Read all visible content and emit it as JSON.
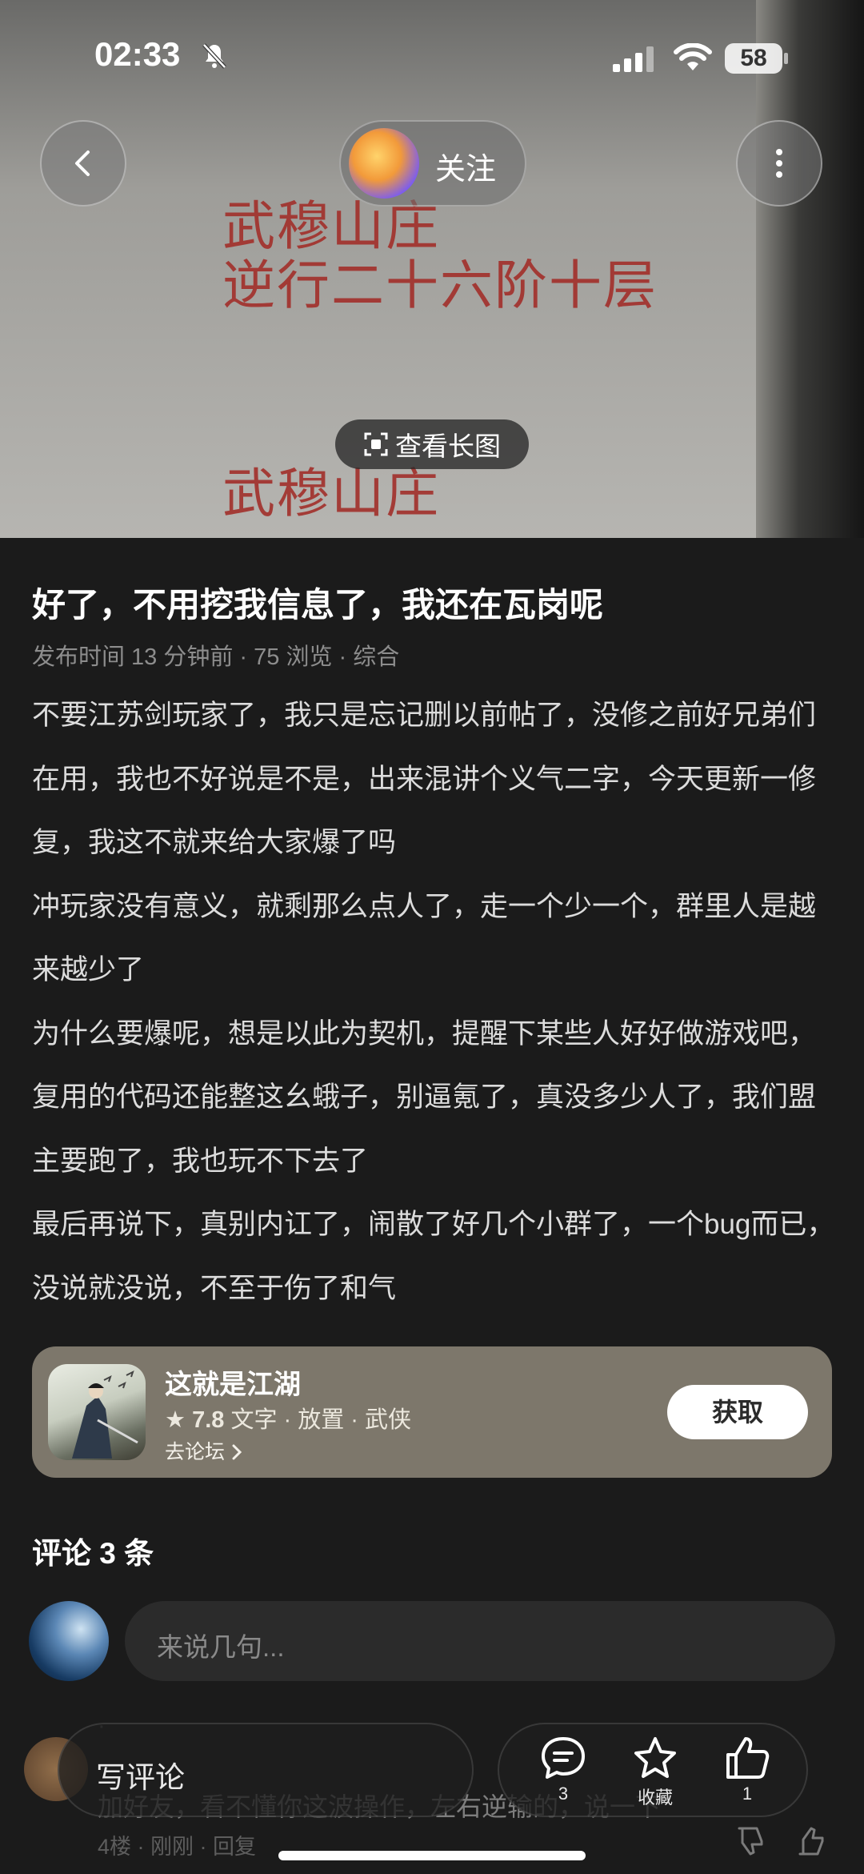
{
  "status_bar": {
    "time": "02:33",
    "battery": "58"
  },
  "hero_image": {
    "lines": [
      "武穆山庄",
      "逆行二十六阶十层",
      "武穆山庄"
    ]
  },
  "top_nav": {
    "follow_label": "关注",
    "view_long_image": "查看长图"
  },
  "post": {
    "title": "好了，不用挖我信息了，我还在瓦岗呢",
    "meta": "发布时间 13 分钟前 · 75 浏览 · 综合",
    "paragraphs": [
      "不要江苏剑玩家了，我只是忘记删以前帖了，没修之前好兄弟们在用，我也不好说是不是，出来混讲个义气二字，今天更新一修复，我这不就来给大家爆了吗",
      "冲玩家没有意义，就剩那么点人了，走一个少一个，群里人是越来越少了",
      "为什么要爆呢，想是以此为契机，提醒下某些人好好做游戏吧，复用的代码还能整这幺蛾子，别逼氪了，真没多少人了，我们盟主要跑了，我也玩不下去了",
      "最后再说下，真别内讧了，闹散了好几个小群了，一个bug而已，没说就没说，不至于伤了和气"
    ]
  },
  "game_card": {
    "name": "这就是江湖",
    "rating": "7.8",
    "tags": "文字 · 放置 · 武侠",
    "forum_link": "去论坛",
    "get_button": "获取",
    "accent_color": "#7d776b"
  },
  "comments": {
    "header": "评论 3 条",
    "input_placeholder": "来说几句...",
    "items": [
      {
        "name": "·",
        "text": "加好友，看不懂你这波操作，左右逆输的，说一下",
        "meta": "4楼 · 刚刚 · 回复"
      }
    ]
  },
  "bottom_bar": {
    "write_label": "写评论",
    "comment_count": "3",
    "favorite_label": "收藏",
    "like_count": "1"
  }
}
